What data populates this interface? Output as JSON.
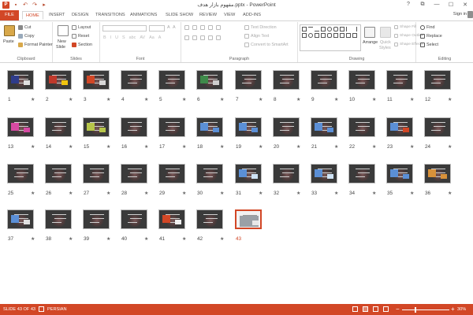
{
  "window": {
    "title": "مفهوم بازار هدف.pptx - PowerPoint",
    "controls": [
      "?",
      "⧉",
      "—",
      "☐",
      "✕"
    ]
  },
  "qat": [
    "save-icon",
    "undo-icon",
    "redo-icon",
    "start-slideshow-icon"
  ],
  "tabs": [
    "FILE",
    "HOME",
    "INSERT",
    "DESIGN",
    "TRANSITIONS",
    "ANIMATIONS",
    "SLIDE SHOW",
    "REVIEW",
    "VIEW",
    "ADD-INS"
  ],
  "active_tab": "HOME",
  "account": {
    "signin": "Sign in"
  },
  "ribbon": {
    "clipboard": {
      "paste": "Paste",
      "cut": "Cut",
      "copy": "Copy",
      "format_painter": "Format Painter",
      "label": "Clipboard"
    },
    "slides": {
      "new_slide": "New",
      "new_slide2": "Slide",
      "layout": "Layout",
      "reset": "Reset",
      "section": "Section",
      "label": "Slides"
    },
    "font": {
      "label": "Font"
    },
    "paragraph": {
      "text_direction": "Text Direction",
      "align_text": "Align Text",
      "convert_smartart": "Convert to SmartArt",
      "label": "Paragraph"
    },
    "drawing": {
      "arrange": "Arrange",
      "quick_styles": "Quick",
      "quick_styles2": "Styles",
      "shape_fill": "Shape Fill",
      "shape_outline": "Shape Outline",
      "shape_effects": "Shape Effects",
      "label": "Drawing"
    },
    "editing": {
      "find": "Find",
      "replace": "Replace",
      "select": "Select",
      "label": "Editing"
    }
  },
  "slides": {
    "labels": [
      "1",
      "2",
      "3",
      "4",
      "5",
      "6",
      "7",
      "8",
      "9",
      "10",
      "11",
      "12",
      "13",
      "14",
      "15",
      "16",
      "17",
      "18",
      "19",
      "20",
      "21",
      "22",
      "23",
      "24",
      "25",
      "26",
      "27",
      "28",
      "29",
      "30",
      "31",
      "32",
      "33",
      "34",
      "35",
      "36",
      "37",
      "38",
      "39",
      "40",
      "41",
      "42",
      "43"
    ],
    "star": "★",
    "selected": 43
  },
  "status": {
    "slide": "SLIDE 43 OF 43",
    "language": "PERSIAN",
    "zoom": "30%",
    "zoom_minus": "−",
    "zoom_plus": "+"
  },
  "colors": {
    "accent": "#d24726"
  }
}
